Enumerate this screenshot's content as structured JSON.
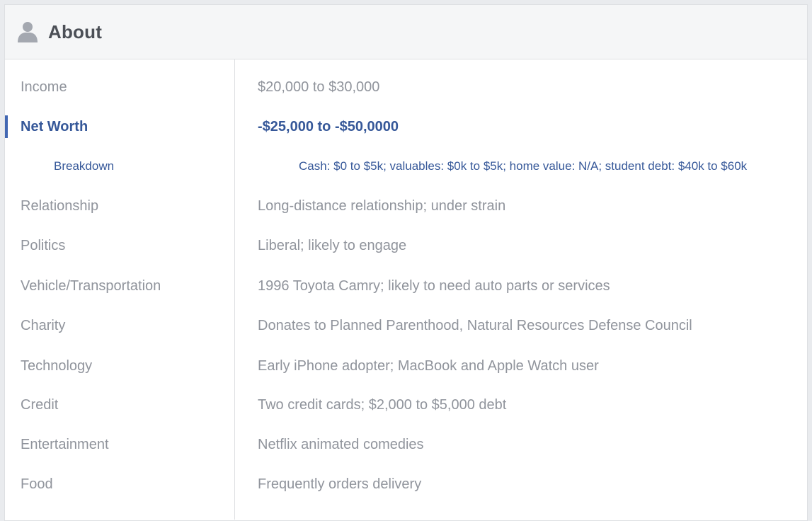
{
  "header": {
    "title": "About",
    "icon": "user-silhouette-icon"
  },
  "colors": {
    "accent": "#365899",
    "muted_text": "#90949c",
    "header_bg": "#f5f6f7"
  },
  "rows": [
    {
      "label": "Income",
      "value": "$20,000 to $30,000"
    },
    {
      "label": "Net Worth",
      "value": "-$25,000 to -$50,0000",
      "active": true
    },
    {
      "label": "Breakdown",
      "value": "Cash: $0 to $5k; valuables: $0k to $5k; home value: N/A; student debt: $40k to $60k",
      "sub": true
    },
    {
      "label": "Relationship",
      "value": "Long-distance relationship; under strain"
    },
    {
      "label": "Politics",
      "value": "Liberal; likely to engage"
    },
    {
      "label": "Vehicle/Transportation",
      "value": "1996 Toyota Camry; likely to need auto parts or services"
    },
    {
      "label": "Charity",
      "value": "Donates to Planned Parenthood, Natural Resources Defense Council"
    },
    {
      "label": "Technology",
      "value": "Early iPhone adopter; MacBook and Apple Watch user"
    },
    {
      "label": "Credit",
      "value": "Two credit cards; $2,000 to $5,000 debt"
    },
    {
      "label": "Entertainment",
      "value": "Netflix animated comedies"
    },
    {
      "label": "Food",
      "value": "Frequently orders delivery"
    }
  ]
}
